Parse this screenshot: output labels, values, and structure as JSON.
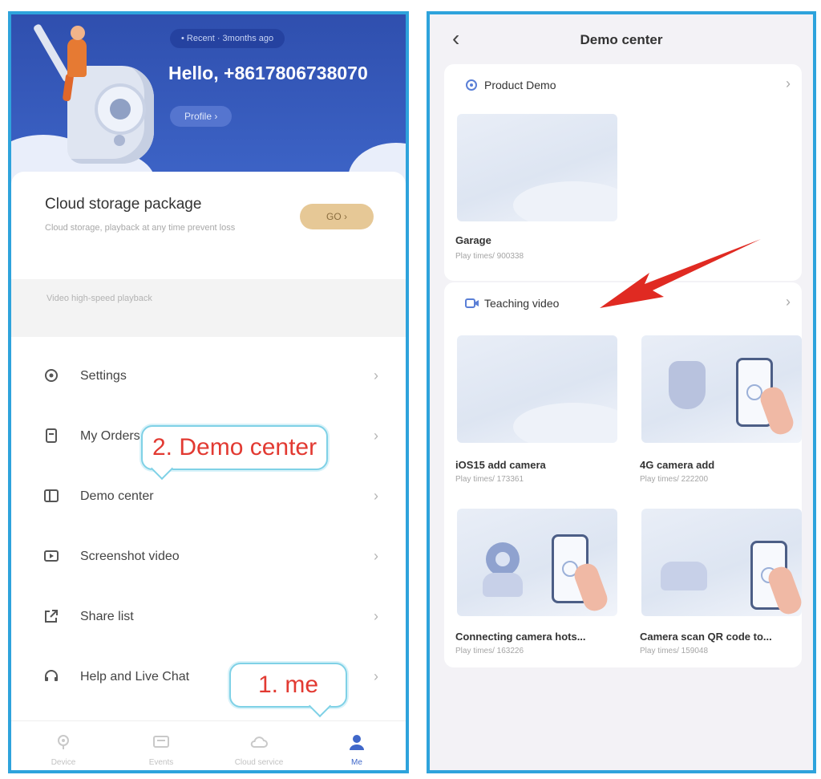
{
  "left": {
    "header": {
      "status_pill": "• Recent · 3months ago",
      "greeting": "Hello, +8617806738070",
      "profile_button": "Profile ›"
    },
    "cloud_card": {
      "title": "Cloud storage package",
      "subtitle": "Cloud storage, playback at any time prevent loss",
      "go_button": "GO ›",
      "strip_text": "Video high-speed playback"
    },
    "menu": [
      {
        "label": "Settings",
        "icon": "gear-icon"
      },
      {
        "label": "My Orders",
        "icon": "orders-icon"
      },
      {
        "label": "Demo center",
        "icon": "demo-icon"
      },
      {
        "label": "Screenshot video",
        "icon": "video-icon"
      },
      {
        "label": "Share list",
        "icon": "share-icon"
      },
      {
        "label": "Help and Live Chat",
        "icon": "headset-icon"
      }
    ],
    "callouts": {
      "demo": "2. Demo center",
      "me": "1. me"
    },
    "tabbar": [
      {
        "label": "Device",
        "icon": "device-icon"
      },
      {
        "label": "Events",
        "icon": "events-icon"
      },
      {
        "label": "Cloud service",
        "icon": "cloud-icon"
      },
      {
        "label": "Me",
        "icon": "person-icon",
        "active": true
      }
    ],
    "accent_color": "#3f67c9",
    "header_color": "#3552b5"
  },
  "right": {
    "nav": {
      "title": "Demo center"
    },
    "product_demo": {
      "title": "Product Demo",
      "items": [
        {
          "title": "Garage",
          "meta": "Play times/ 900338"
        }
      ]
    },
    "teaching_video": {
      "title": "Teaching video",
      "items": [
        {
          "title": "iOS15 add camera",
          "meta": "Play times/ 173361"
        },
        {
          "title": "4G camera add",
          "meta": "Play times/ 222200"
        },
        {
          "title": "Connecting camera hots...",
          "meta": "Play times/ 163226"
        },
        {
          "title": "Camera scan QR code to...",
          "meta": "Play times/ 159048"
        }
      ]
    },
    "annotation_color": "#e02a22"
  }
}
